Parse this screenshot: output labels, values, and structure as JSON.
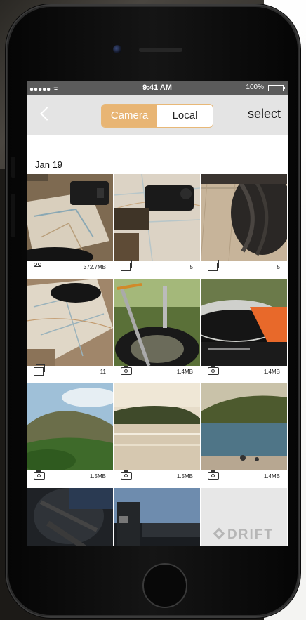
{
  "status_bar": {
    "carrier": "●●●●● ᯤ",
    "time": "9:41 AM",
    "battery": "100%"
  },
  "nav": {
    "back_icon": "chevron-left-icon",
    "segments": [
      {
        "label": "Camera",
        "selected": true
      },
      {
        "label": "Local",
        "selected": false
      }
    ],
    "select_label": "select"
  },
  "gallery": {
    "date": "Jan 19",
    "items": [
      {
        "type": "video",
        "icon": "video-camera-icon",
        "meta": "372.7MB"
      },
      {
        "type": "burst",
        "icon": "photo-stack-icon",
        "meta": "5"
      },
      {
        "type": "burst",
        "icon": "photo-stack-icon",
        "meta": "5"
      },
      {
        "type": "burst",
        "icon": "photo-stack-icon",
        "meta": "11"
      },
      {
        "type": "photo",
        "icon": "camera-icon",
        "meta": "1.4MB"
      },
      {
        "type": "photo",
        "icon": "camera-icon",
        "meta": "1.4MB"
      },
      {
        "type": "photo",
        "icon": "camera-icon",
        "meta": "1.5MB"
      },
      {
        "type": "photo",
        "icon": "camera-icon",
        "meta": "1.5MB"
      },
      {
        "type": "photo",
        "icon": "camera-icon",
        "meta": "1.4MB"
      },
      {
        "type": "photo",
        "icon": "",
        "meta": ""
      },
      {
        "type": "photo",
        "icon": "",
        "meta": ""
      },
      {
        "type": "placeholder",
        "icon": "drift-logo",
        "meta": ""
      }
    ],
    "placeholder_logo": "DRIFT"
  },
  "colors": {
    "accent": "#e8b574",
    "navbar": "#e4e4e4",
    "status_bar": "#5b5b5b"
  }
}
